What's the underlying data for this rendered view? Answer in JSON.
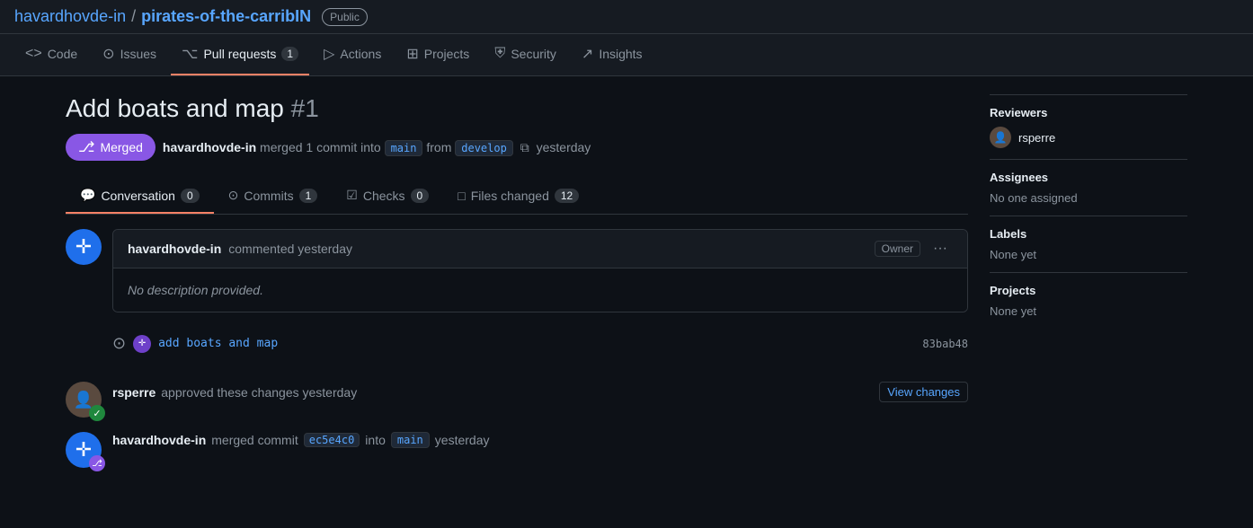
{
  "repo": {
    "owner": "havardhovde-in",
    "slash": "/",
    "name": "pirates-of-the-carribIN",
    "visibility": "Public"
  },
  "nav": {
    "tabs": [
      {
        "id": "code",
        "icon": "◁",
        "label": "Code",
        "count": null,
        "active": false
      },
      {
        "id": "issues",
        "icon": "○",
        "label": "Issues",
        "count": null,
        "active": false
      },
      {
        "id": "pull-requests",
        "icon": "⌥",
        "label": "Pull requests",
        "count": "1",
        "active": true
      },
      {
        "id": "actions",
        "icon": "▷",
        "label": "Actions",
        "count": null,
        "active": false
      },
      {
        "id": "projects",
        "icon": "⊞",
        "label": "Projects",
        "count": null,
        "active": false
      },
      {
        "id": "security",
        "icon": "⛨",
        "label": "Security",
        "count": null,
        "active": false
      },
      {
        "id": "insights",
        "icon": "⤴",
        "label": "Insights",
        "count": null,
        "active": false
      }
    ]
  },
  "pr": {
    "title": "Add boats and map",
    "number": "#1",
    "status": "Merged",
    "author": "havardhovde-in",
    "action": "merged",
    "commit_count": "1",
    "commit_word": "commit",
    "into_text": "into",
    "base_branch": "main",
    "from_text": "from",
    "head_branch": "develop",
    "time": "yesterday"
  },
  "pr_tabs": [
    {
      "id": "conversation",
      "icon": "💬",
      "label": "Conversation",
      "count": "0",
      "active": true
    },
    {
      "id": "commits",
      "icon": "⊙",
      "label": "Commits",
      "count": "1",
      "active": false
    },
    {
      "id": "checks",
      "icon": "☑",
      "label": "Checks",
      "count": "0",
      "active": false
    },
    {
      "id": "files-changed",
      "icon": "□",
      "label": "Files changed",
      "count": "12",
      "active": false
    }
  ],
  "comment": {
    "username": "havardhovde-in",
    "action": "commented yesterday",
    "body": "No description provided.",
    "owner_label": "Owner",
    "more_icon": "···"
  },
  "commit": {
    "message": "add boats and map",
    "hash": "83bab48",
    "avatar_text": "+"
  },
  "timeline": [
    {
      "id": "approve",
      "username": "rsperre",
      "action": "approved these changes yesterday",
      "link": null,
      "view_changes": "View changes"
    },
    {
      "id": "merge",
      "username": "havardhovde-in",
      "action": "merged commit",
      "commit_link": "ec5e4c0",
      "action2": "into",
      "branch": "main",
      "time": "yesterday"
    }
  ],
  "sidebar": {
    "reviewers_title": "Reviewers",
    "reviewer_name": "rsperre",
    "assignees_title": "Assignees",
    "assignees_value": "No one assigned",
    "labels_title": "Labels",
    "labels_value": "None yet",
    "projects_title": "Projects",
    "projects_value": "None yet"
  }
}
